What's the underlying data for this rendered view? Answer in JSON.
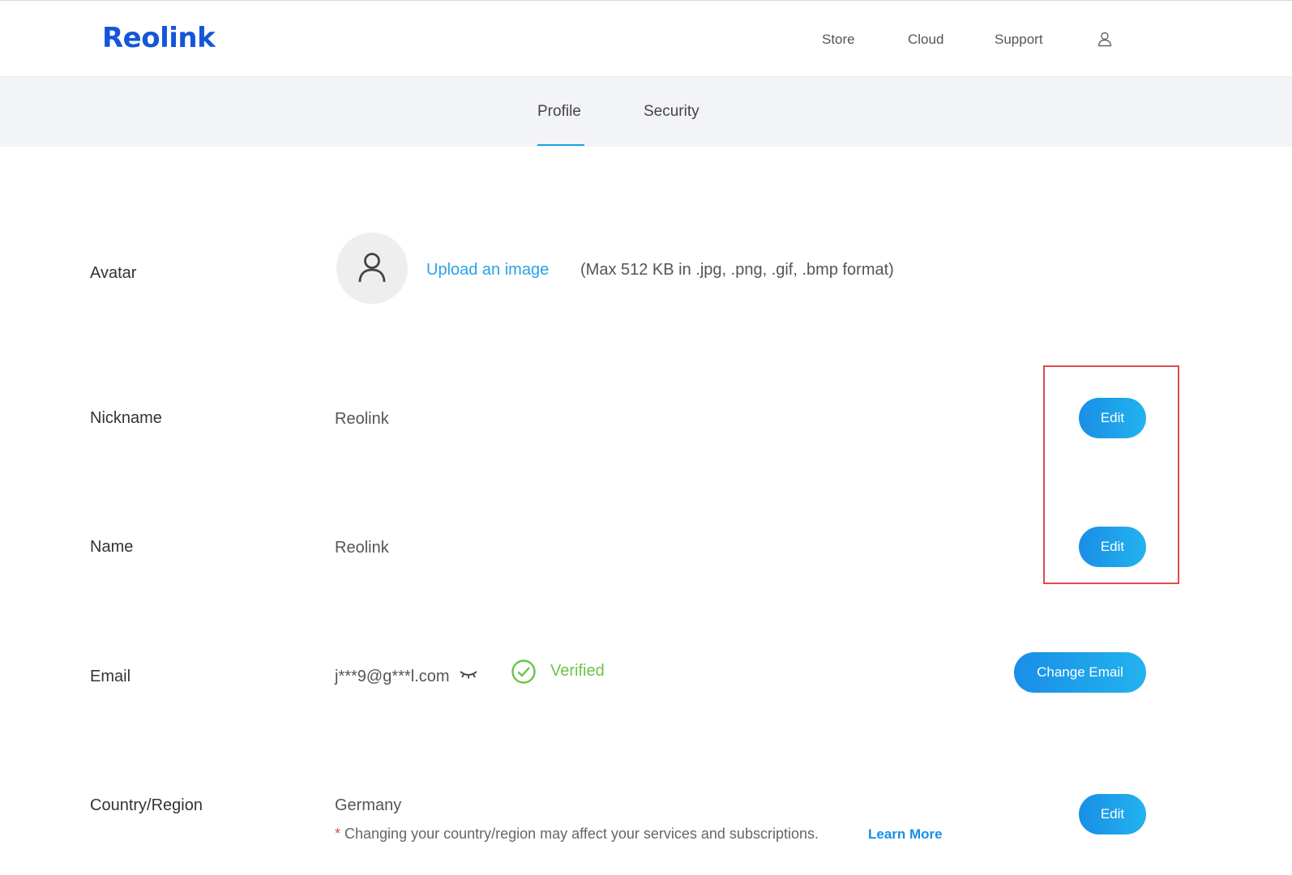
{
  "header": {
    "logo_text": "Reolink",
    "nav": {
      "store": "Store",
      "cloud": "Cloud",
      "support": "Support"
    },
    "user_icon": "user-icon"
  },
  "tabs": {
    "profile": "Profile",
    "security": "Security",
    "active": "Profile"
  },
  "avatar": {
    "label": "Avatar",
    "upload_link": "Upload an image",
    "upload_hint": "(Max 512 KB in .jpg, .png, .gif, .bmp format)"
  },
  "nickname": {
    "label": "Nickname",
    "value": "Reolink",
    "button": "Edit"
  },
  "name": {
    "label": "Name",
    "value": "Reolink",
    "button": "Edit"
  },
  "email": {
    "label": "Email",
    "value": "j***9@g***l.com",
    "status": "Verified",
    "button": "Change Email"
  },
  "country": {
    "label": "Country/Region",
    "value": "Germany",
    "note_asterisk": "*",
    "note": " Changing your country/region may affect your services and subscriptions.",
    "learn_more": "Learn More",
    "button": "Edit"
  },
  "colors": {
    "brand": "#1456d8",
    "accent": "#1aa2e8",
    "verified": "#6cc24a",
    "highlight": "#e04b4b"
  }
}
